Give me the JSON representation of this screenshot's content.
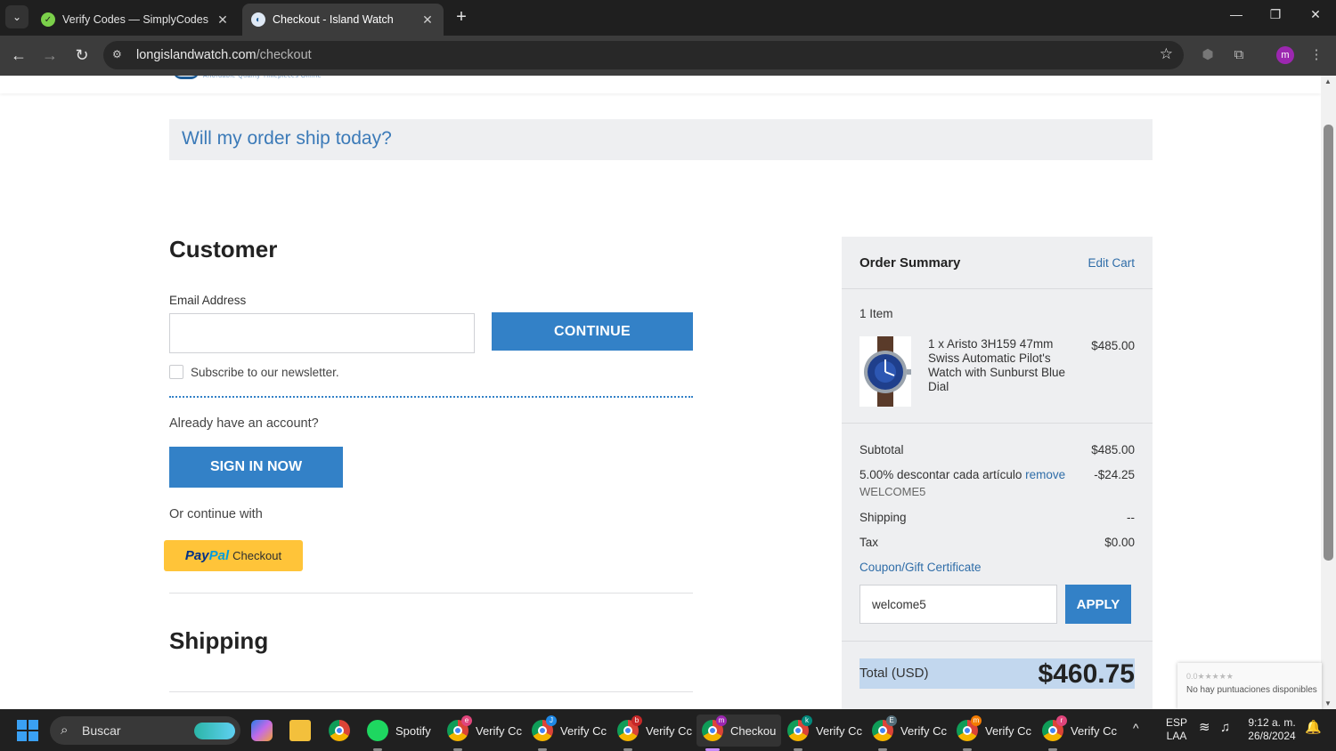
{
  "browser": {
    "tabs": [
      {
        "title": "Verify Codes — SimplyCodes",
        "active": false
      },
      {
        "title": "Checkout - Island Watch",
        "active": true
      }
    ],
    "url_host": "longislandwatch.com",
    "url_path": "/checkout"
  },
  "page": {
    "ship_banner": "Will my order ship today?",
    "customer": {
      "heading": "Customer",
      "email_label": "Email Address",
      "email_value": "",
      "continue_label": "CONTINUE",
      "newsletter_label": "Subscribe to our newsletter.",
      "already_account": "Already have an account?",
      "signin_label": "SIGN IN NOW",
      "or_continue": "Or continue with",
      "paypal": {
        "pay": "Pay",
        "pal": "Pal",
        "checkout": "Checkout"
      }
    },
    "shipping_heading": "Shipping"
  },
  "summary": {
    "title": "Order Summary",
    "edit_cart": "Edit Cart",
    "item_count": "1 Item",
    "product": {
      "name": "1 x Aristo 3H159 47mm Swiss Automatic Pilot's Watch with Sunburst Blue Dial",
      "price": "$485.00"
    },
    "subtotal_label": "Subtotal",
    "subtotal_value": "$485.00",
    "discount_label": "5.00% descontar cada artículo",
    "discount_remove": "remove",
    "discount_value": "-$24.25",
    "discount_code": "WELCOME5",
    "shipping_label": "Shipping",
    "shipping_value": "--",
    "tax_label": "Tax",
    "tax_value": "$0.00",
    "coupon_label": "Coupon/Gift Certificate",
    "coupon_value": "welcome5",
    "apply_label": "APPLY",
    "total_label": "Total (USD)",
    "total_value": "$460.75"
  },
  "recaptcha": {
    "stars": "0.0★★★★★",
    "text": "No hay puntuaciones disponibles"
  },
  "taskbar": {
    "search_placeholder": "Buscar",
    "apps": [
      {
        "label": "Spotify"
      },
      {
        "label": "Verify Cc",
        "badge": "e",
        "badge_color": "#e0457b"
      },
      {
        "label": "Verify Cc",
        "badge": "J",
        "badge_color": "#1e88e5"
      },
      {
        "label": "Verify Cc",
        "badge": "b",
        "badge_color": "#c62828"
      },
      {
        "label": "Checkou",
        "badge": "m",
        "badge_color": "#9c27b0"
      },
      {
        "label": "Verify Cc",
        "badge": "k",
        "badge_color": "#00897b"
      },
      {
        "label": "Verify Cc",
        "badge": "E",
        "badge_color": "#546e7a"
      },
      {
        "label": "Verify Cc",
        "badge": "m",
        "badge_color": "#f57c00"
      },
      {
        "label": "Verify Cc",
        "badge": "r",
        "badge_color": "#e0457b"
      }
    ],
    "lang_top": "ESP",
    "lang_bottom": "LAA",
    "time": "9:12 a. m.",
    "date": "26/8/2024"
  }
}
